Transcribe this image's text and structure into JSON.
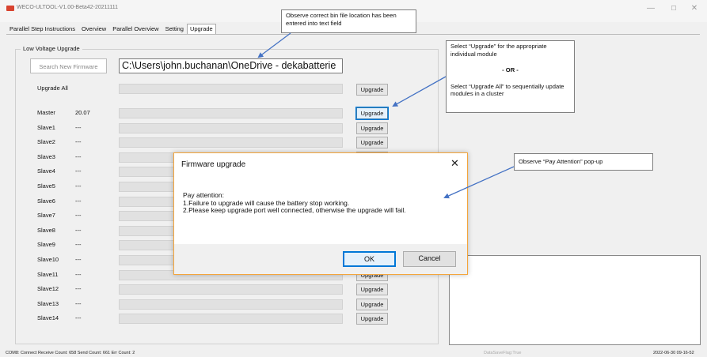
{
  "window": {
    "title": "WECO-ULTOOL-V1.00-Beta42-20211111",
    "minimize": "—",
    "maximize": "☐",
    "close": "✕"
  },
  "tabs": [
    "Parallel Step Instructions",
    "Overview",
    "Parallel Overview",
    "Setting",
    "Upgrade"
  ],
  "group_label": "Low Voltage Upgrade",
  "search_button": "Search New Firmware",
  "path_value": "C:\\Users\\john.buchanan\\OneDrive - dekabatterie",
  "upgrade_all_label": "Upgrade All",
  "upgrade_label": "Upgrade",
  "modules": [
    {
      "name": "Master",
      "version": "20.07"
    },
    {
      "name": "Slave1",
      "version": "---"
    },
    {
      "name": "Slave2",
      "version": "---"
    },
    {
      "name": "Slave3",
      "version": "---"
    },
    {
      "name": "Slave4",
      "version": "---"
    },
    {
      "name": "Slave5",
      "version": "---"
    },
    {
      "name": "Slave6",
      "version": "---"
    },
    {
      "name": "Slave7",
      "version": "---"
    },
    {
      "name": "Slave8",
      "version": "---"
    },
    {
      "name": "Slave9",
      "version": "---"
    },
    {
      "name": "Slave10",
      "version": "---"
    },
    {
      "name": "Slave11",
      "version": "---"
    },
    {
      "name": "Slave12",
      "version": "---"
    },
    {
      "name": "Slave13",
      "version": "---"
    },
    {
      "name": "Slave14",
      "version": "---"
    }
  ],
  "status": {
    "left": "COM8: Connect  Receive Count: 658  Send Count: 661  Err Count: 2",
    "middle": "DataSaveFlag:True",
    "right": "2022-06-30 09-16-52"
  },
  "dialog": {
    "title": "Firmware upgrade",
    "close": "✕",
    "line1": "Pay attention:",
    "line2": "1.Failure to upgrade will cause the battery stop working.",
    "line3": "2.Please keep upgrade port well connected, otherwise the upgrade will fail.",
    "ok": "OK",
    "cancel": "Cancel"
  },
  "callouts": {
    "bin_location": "Observe correct bin file location has been entered into text field",
    "select_upgrade": "Select “Upgrade” for the appropriate individual module",
    "or": "- OR -",
    "select_upgrade_all": "Select “Upgrade All” to sequentially update modules in a cluster",
    "pay_attention": "Observe “Pay Attention” pop-up"
  }
}
